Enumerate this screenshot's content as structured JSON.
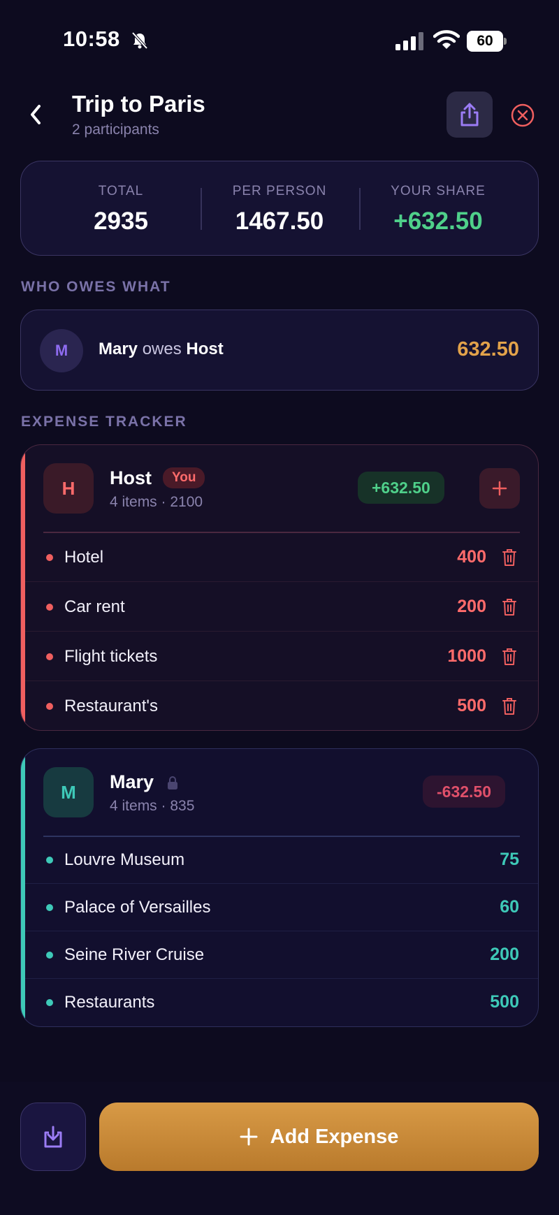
{
  "status_bar": {
    "time": "10:58",
    "battery": "60"
  },
  "header": {
    "title": "Trip to Paris",
    "subtitle": "2 participants"
  },
  "summary": {
    "total_label": "TOTAL",
    "total_value": "2935",
    "per_person_label": "PER PERSON",
    "per_person_value": "1467.50",
    "your_share_label": "YOUR SHARE",
    "your_share_value": "+632.50"
  },
  "owes": {
    "section_title": "WHO OWES WHAT",
    "avatar": "M",
    "debtor": "Mary",
    "verb": "owes",
    "creditor": "Host",
    "amount": "632.50"
  },
  "tracker": {
    "section_title": "EXPENSE TRACKER",
    "participants": [
      {
        "avatar": "H",
        "name": "Host",
        "badge": "You",
        "meta": "4 items · 2100",
        "balance": "+632.50",
        "items": [
          {
            "name": "Hotel",
            "amount": "400"
          },
          {
            "name": "Car rent",
            "amount": "200"
          },
          {
            "name": "Flight tickets",
            "amount": "1000"
          },
          {
            "name": "Restaurant's",
            "amount": "500"
          }
        ]
      },
      {
        "avatar": "M",
        "name": "Mary",
        "meta": "4 items · 835",
        "balance": "-632.50",
        "items": [
          {
            "name": "Louvre Museum",
            "amount": "75"
          },
          {
            "name": "Palace of Versailles",
            "amount": "60"
          },
          {
            "name": "Seine River Cruise",
            "amount": "200"
          },
          {
            "name": "Restaurants",
            "amount": "500"
          }
        ]
      }
    ]
  },
  "bottom": {
    "add_expense_label": "Add Expense"
  },
  "colors": {
    "background": "#0d0b1f",
    "positive": "#4fd08a",
    "owed_amount": "#e2a24a",
    "host_accent": "#ef5f5f",
    "mary_accent": "#3ec9b8",
    "negative": "#e0506a",
    "button_gold": "#d08e3c"
  }
}
